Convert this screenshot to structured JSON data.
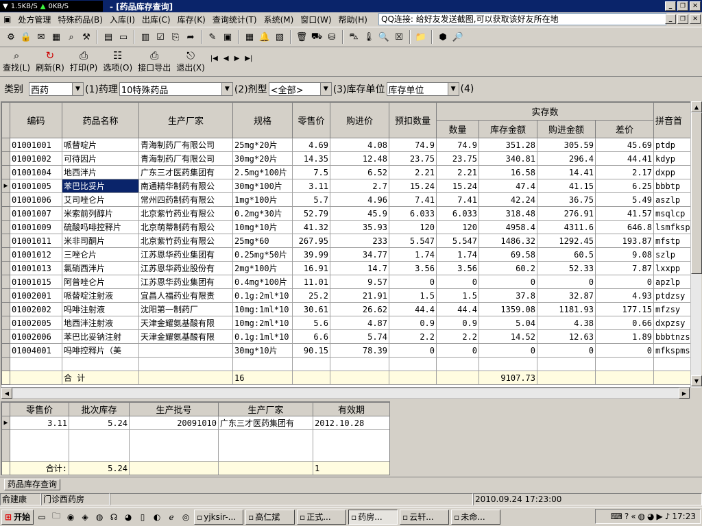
{
  "net": {
    "up": "1.5KB/S",
    "down": "0KB/S"
  },
  "window_title": "- [药品库存查询]",
  "menu": [
    "处方管理",
    "特殊药品(B)",
    "入库(I)",
    "出库(C)",
    "库存(K)",
    "查询统计(T)",
    "系统(M)",
    "窗口(W)",
    "帮助(H)"
  ],
  "qq_notice": "QQ连接: 给好友发送截图,可以获取该好友所在地",
  "toolbar2": [
    {
      "icon": "search-icon",
      "label": "查找(L)"
    },
    {
      "icon": "refresh-icon",
      "label": "刷新(R)"
    },
    {
      "icon": "print-icon",
      "label": "打印(P)"
    },
    {
      "icon": "options-icon",
      "label": "选项(O)"
    },
    {
      "icon": "export-icon",
      "label": "接口导出"
    },
    {
      "icon": "exit-icon",
      "label": "退出(X)"
    }
  ],
  "nav_glyphs": [
    "|◀",
    "◀",
    "▶",
    "▶|"
  ],
  "filter": {
    "category_label": "类别",
    "category_value": "西药",
    "pharm_label": "(1)药理",
    "pharm_value": "10特殊药品",
    "form_label": "(2)剂型",
    "form_value": "<全部>",
    "unit_label": "(3)库存单位",
    "unit_value": "库存单位",
    "tail_label": "(4)"
  },
  "grid": {
    "headers": [
      "编码",
      "药品名称",
      "生产厂家",
      "规格",
      "零售价",
      "购进价",
      "预扣数量",
      "数量",
      "库存金额",
      "购进金额",
      "差价",
      "拼音首"
    ],
    "group_header": "实存数",
    "rows": [
      [
        "01001001",
        "哌替啶片",
        "青海制药厂有限公司",
        "25mg*20片",
        "4.69",
        "4.08",
        "74.9",
        "74.9",
        "351.28",
        "305.59",
        "45.69",
        "ptdp"
      ],
      [
        "01001002",
        "可待因片",
        "青海制药厂有限公司",
        "30mg*20片",
        "14.35",
        "12.48",
        "23.75",
        "23.75",
        "340.81",
        "296.4",
        "44.41",
        "kdyp"
      ],
      [
        "01001004",
        "地西泮片",
        "广东三才医药集团有",
        "2.5mg*100片",
        "7.5",
        "6.52",
        "2.21",
        "2.21",
        "16.58",
        "14.41",
        "2.17",
        "dxpp"
      ],
      [
        "01001005",
        "苯巴比妥片",
        "南通精华制药有限公",
        "30mg*100片",
        "3.11",
        "2.7",
        "15.24",
        "15.24",
        "47.4",
        "41.15",
        "6.25",
        "bbbtp"
      ],
      [
        "01001006",
        "艾司唑仑片",
        "常州四药制药有限公",
        "1mg*100片",
        "5.7",
        "4.96",
        "7.41",
        "7.41",
        "42.24",
        "36.75",
        "5.49",
        "aszlp"
      ],
      [
        "01001007",
        "米索前列醇片",
        "北京紫竹药业有限公",
        "0.2mg*30片",
        "52.79",
        "45.9",
        "6.033",
        "6.033",
        "318.48",
        "276.91",
        "41.57",
        "msqlcp"
      ],
      [
        "01001009",
        "硫酸吗啡控释片",
        "北京萌蒂制药有限公",
        "10mg*10片",
        "41.32",
        "35.93",
        "120",
        "120",
        "4958.4",
        "4311.6",
        "646.8",
        "lsmfksp"
      ],
      [
        "01001011",
        "米非司酮片",
        "北京紫竹药业有限公",
        "25mg*60",
        "267.95",
        "233",
        "5.547",
        "5.547",
        "1486.32",
        "1292.45",
        "193.87",
        "mfstp"
      ],
      [
        "01001012",
        "三唑仑片",
        "江苏恩华药业集团有",
        "0.25mg*50片",
        "39.99",
        "34.77",
        "1.74",
        "1.74",
        "69.58",
        "60.5",
        "9.08",
        "szlp"
      ],
      [
        "01001013",
        "氯硝西泮片",
        "江苏恩华药业股份有",
        "2mg*100片",
        "16.91",
        "14.7",
        "3.56",
        "3.56",
        "60.2",
        "52.33",
        "7.87",
        "lxxpp"
      ],
      [
        "01001015",
        "阿普唑仑片",
        "江苏恩华药业集团有",
        "0.4mg*100片",
        "11.01",
        "9.57",
        "0",
        "0",
        "0",
        "0",
        "0",
        "apzlp"
      ],
      [
        "01002001",
        "哌替啶注射液",
        "宜昌人福药业有限责",
        "0.1g:2ml*10",
        "25.2",
        "21.91",
        "1.5",
        "1.5",
        "37.8",
        "32.87",
        "4.93",
        "ptdzsy"
      ],
      [
        "01002002",
        "吗啡注射液",
        "沈阳第一制药厂",
        "10mg:1ml*10",
        "30.61",
        "26.62",
        "44.4",
        "44.4",
        "1359.08",
        "1181.93",
        "177.15",
        "mfzsy"
      ],
      [
        "01002005",
        "地西泮注射液",
        "天津金耀氨基酸有限",
        "10mg:2ml*10",
        "5.6",
        "4.87",
        "0.9",
        "0.9",
        "5.04",
        "4.38",
        "0.66",
        "dxpzsy"
      ],
      [
        "01002006",
        "苯巴比妥钠注射",
        "天津金耀氨基酸有限",
        "0.1g:1ml*10",
        "6.6",
        "5.74",
        "2.2",
        "2.2",
        "14.52",
        "12.63",
        "1.89",
        "bbbtnzs"
      ],
      [
        "01004001",
        "吗啡控释片（美",
        "",
        "30mg*10片",
        "90.15",
        "78.39",
        "0",
        "0",
        "0",
        "0",
        "0",
        "mfkspms"
      ]
    ],
    "selected_row": 3,
    "sum_label": "合  计",
    "sum_spec": "16",
    "sum_amount": "9107.73"
  },
  "batch": {
    "headers": [
      "零售价",
      "批次库存",
      "生产批号",
      "生产厂家",
      "有效期"
    ],
    "rows": [
      [
        "3.11",
        "5.24",
        "20091010",
        "广东三才医药集团有",
        "2012.10.28"
      ]
    ],
    "sum_label": "合计:",
    "sum_stock": "5.24",
    "sum_expiry": "1"
  },
  "tab_label": "药品库存查询",
  "status": {
    "user": "俞建康",
    "dept": "门诊西药房",
    "datetime": "2010.09.24 17:23:00"
  },
  "taskbar": {
    "start": "开始",
    "tasks": [
      "yjksir-...",
      "高仁斌",
      "正式...",
      "药房...",
      "云轩...",
      "未命..."
    ],
    "active": 3,
    "clock": "17:23"
  }
}
